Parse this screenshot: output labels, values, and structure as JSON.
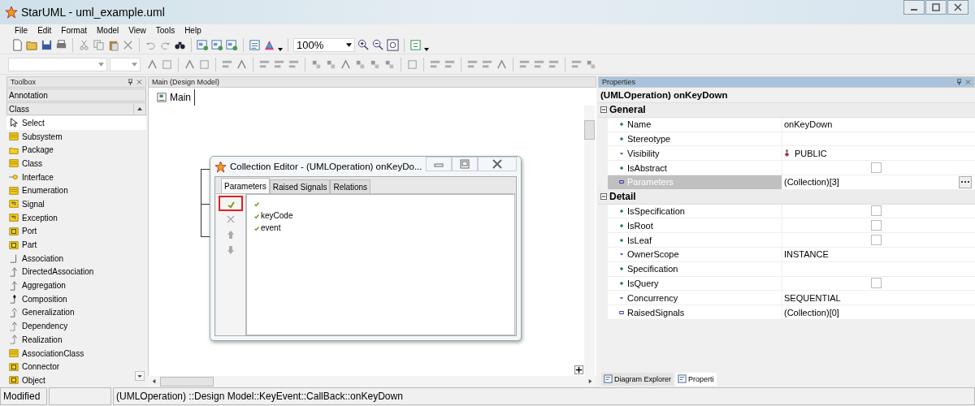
{
  "window": {
    "title": "StarUML - uml_example.uml"
  },
  "menu": [
    "File",
    "Edit",
    "Format",
    "Model",
    "View",
    "Tools",
    "Help"
  ],
  "toolbar": {
    "zoom": "100%"
  },
  "toolbox": {
    "title": "Toolbox",
    "sections": [
      {
        "label": "Annotation",
        "expanded": false
      },
      {
        "label": "Class",
        "expanded": true
      }
    ],
    "items": [
      {
        "label": "Select",
        "selected": true
      },
      {
        "label": "Subsystem",
        "selected": false
      },
      {
        "label": "Package",
        "selected": false
      },
      {
        "label": "Class",
        "selected": false
      },
      {
        "label": "Interface",
        "selected": false
      },
      {
        "label": "Enumeration",
        "selected": false
      },
      {
        "label": "Signal",
        "selected": false
      },
      {
        "label": "Exception",
        "selected": false
      },
      {
        "label": "Port",
        "selected": false
      },
      {
        "label": "Part",
        "selected": false
      },
      {
        "label": "Association",
        "selected": false
      },
      {
        "label": "DirectedAssociation",
        "selected": false
      },
      {
        "label": "Aggregation",
        "selected": false
      },
      {
        "label": "Composition",
        "selected": false
      },
      {
        "label": "Generalization",
        "selected": false
      },
      {
        "label": "Dependency",
        "selected": false
      },
      {
        "label": "Realization",
        "selected": false
      },
      {
        "label": "AssociationClass",
        "selected": false
      },
      {
        "label": "Connector",
        "selected": false
      },
      {
        "label": "Object",
        "selected": false
      }
    ]
  },
  "diagram": {
    "header": "Main (Design Model)",
    "tabs": [
      {
        "label": "Main",
        "selected": true
      }
    ]
  },
  "dialog": {
    "title": "Collection Editor - (UMLOperation) onKeyDo...",
    "tabs": [
      {
        "label": "Parameters",
        "selected": true
      },
      {
        "label": "Raised Signals",
        "selected": false
      },
      {
        "label": "Relations",
        "selected": false
      }
    ],
    "tools": [
      {
        "kind": "add",
        "highlighted": true,
        "disabled": false
      },
      {
        "kind": "delete",
        "highlighted": false,
        "disabled": true
      },
      {
        "kind": "up",
        "highlighted": false,
        "disabled": true
      },
      {
        "kind": "down",
        "highlighted": false,
        "disabled": true
      }
    ],
    "items": [
      {
        "kind": "unnamed"
      },
      {
        "kind": "named",
        "name": "keyCode"
      },
      {
        "kind": "named",
        "name": "event"
      }
    ]
  },
  "properties": {
    "title": "Properties",
    "subject": "(UMLOperation) onKeyDown",
    "groups": [
      {
        "label": "General",
        "expanded": true,
        "rows": [
          {
            "name": "Name",
            "kind": "text",
            "value": "onKeyDown",
            "selected": false
          },
          {
            "name": "Stereotype",
            "kind": "text",
            "selected": false
          },
          {
            "name": "Visibility",
            "kind": "visibility",
            "value": "PUBLIC",
            "selected": false
          },
          {
            "name": "IsAbstract",
            "kind": "checkbox",
            "checked": false,
            "selected": false
          },
          {
            "name": "Parameters",
            "kind": "collection",
            "value": "(Collection)[3]",
            "selected": true
          }
        ]
      },
      {
        "label": "Detail",
        "expanded": true,
        "rows": [
          {
            "name": "IsSpecification",
            "kind": "checkbox",
            "checked": false,
            "selected": false
          },
          {
            "name": "IsRoot",
            "kind": "checkbox",
            "checked": false,
            "selected": false
          },
          {
            "name": "IsLeaf",
            "kind": "checkbox",
            "checked": false,
            "selected": false
          },
          {
            "name": "OwnerScope",
            "kind": "enum",
            "value": "INSTANCE",
            "selected": false
          },
          {
            "name": "Specification",
            "kind": "text",
            "selected": false
          },
          {
            "name": "IsQuery",
            "kind": "checkbox",
            "checked": false,
            "selected": false
          },
          {
            "name": "Concurrency",
            "kind": "enum",
            "value": "SEQUENTIAL",
            "selected": false
          },
          {
            "name": "RaisedSignals",
            "kind": "collection",
            "value": "(Collection)[0]",
            "selected": false
          }
        ]
      }
    ],
    "tabs": [
      {
        "label": "Diagram Explorer",
        "selected": false
      },
      {
        "label": "Properti",
        "selected": true
      }
    ]
  },
  "status_bar": {
    "state": "Modified",
    "path": "(UMLOperation) ::Design Model::KeyEvent::CallBack::onKeyDown"
  }
}
